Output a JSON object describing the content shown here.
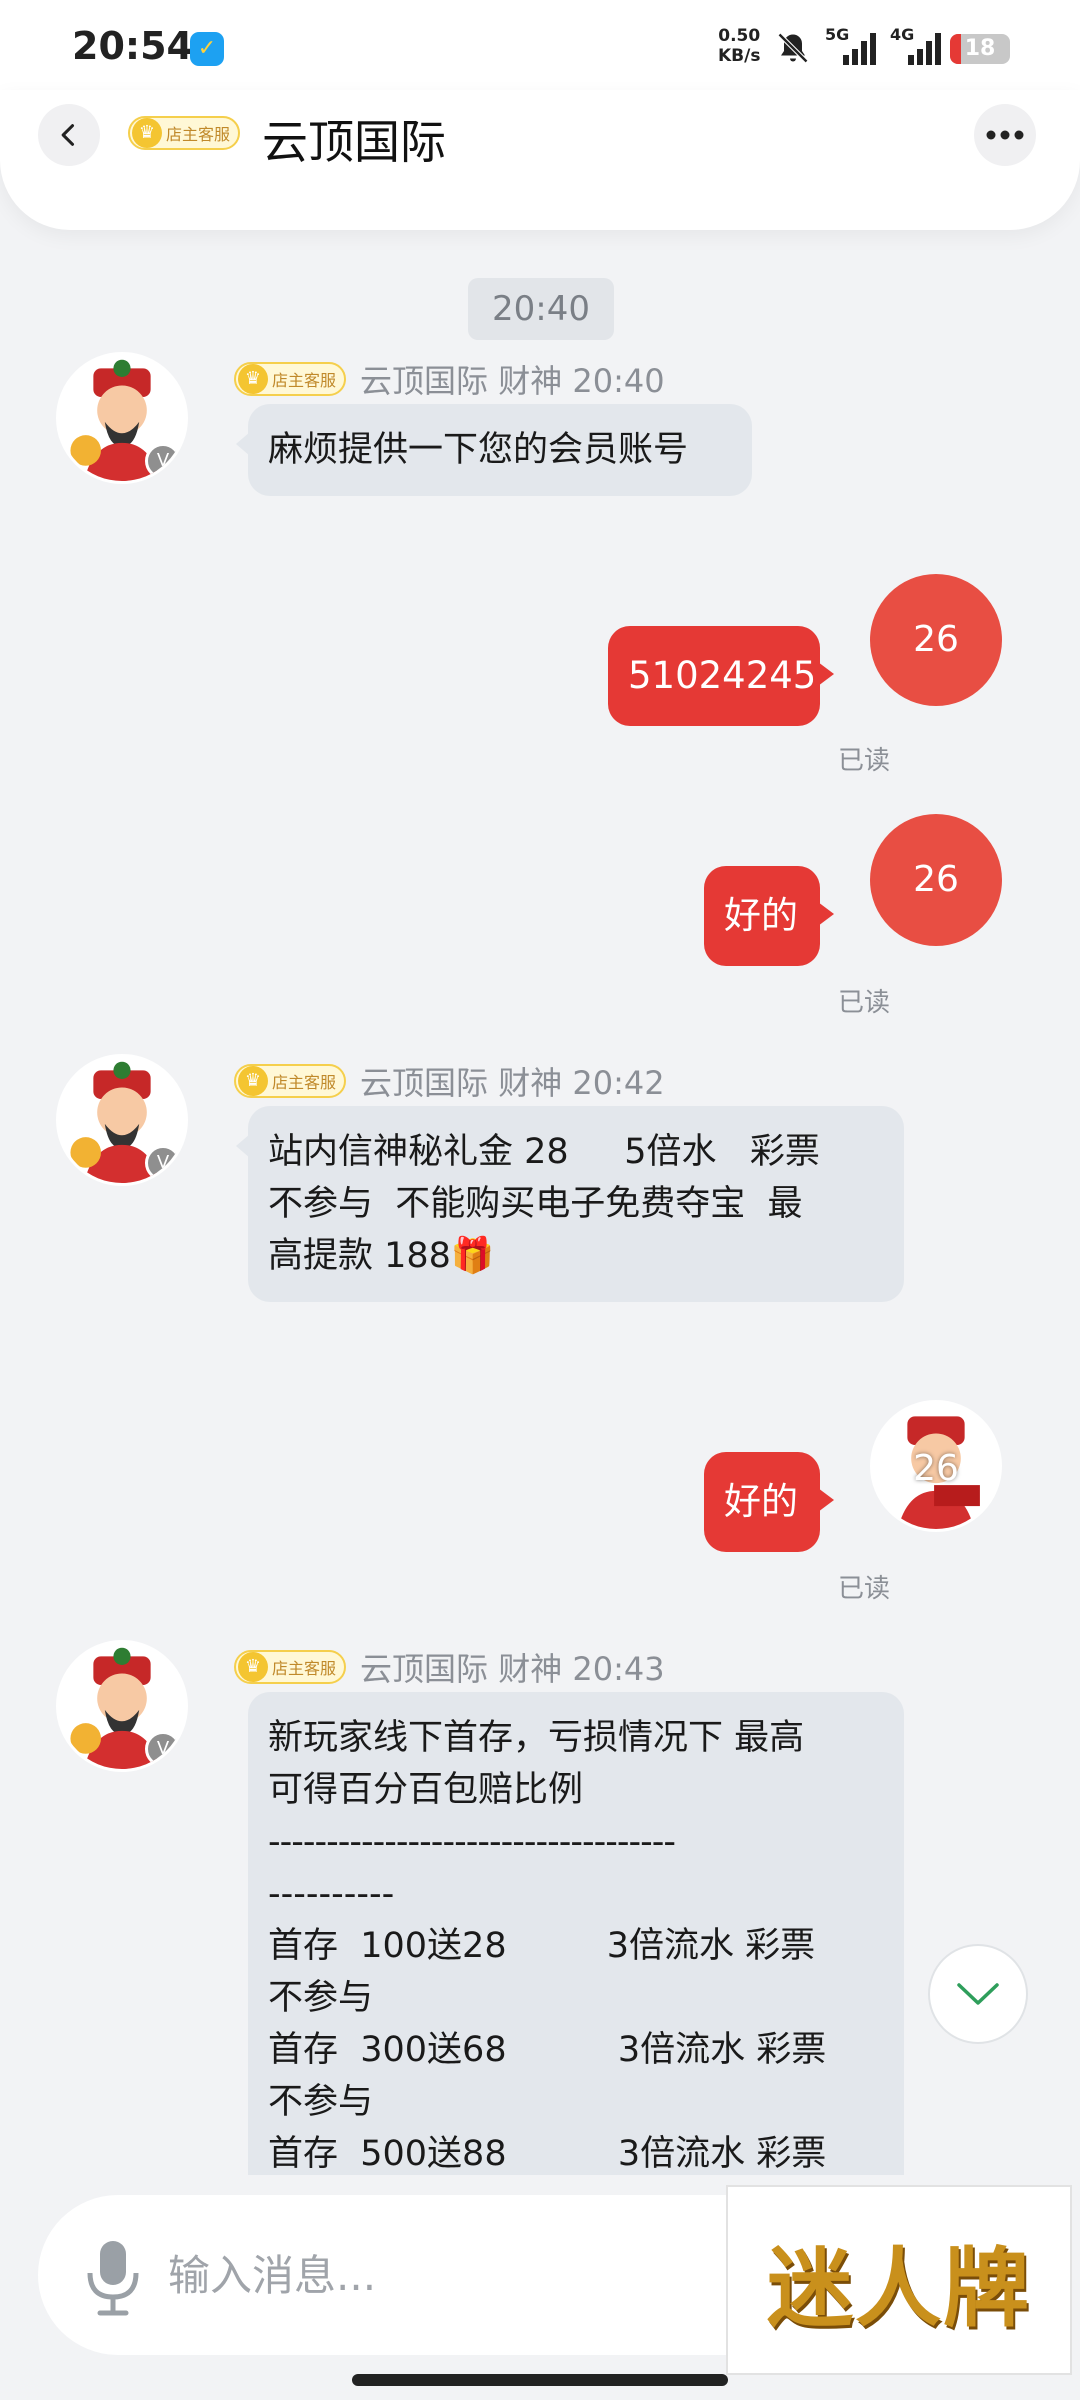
{
  "status_bar": {
    "time": "20:54",
    "net_speed_value": "0.50",
    "net_speed_unit": "KB/s",
    "sim1_label": "5G",
    "sim2_label": "4G",
    "battery": "18",
    "battery_level": 0.18,
    "accent": "#e53935"
  },
  "header": {
    "title": "云顶国际",
    "badge": "店主客服",
    "icons": [
      "back-icon",
      "more-icon"
    ]
  },
  "chat": {
    "time_divider": "20:40",
    "messages": [
      {
        "direction": "in",
        "badge": "店主客服",
        "sender": "云顶国际 财神 20:40",
        "lines": [
          "麻烦提供一下您的会员账号"
        ]
      },
      {
        "direction": "out",
        "text": "51024245",
        "avatar_text": "26",
        "read": "已读"
      },
      {
        "direction": "out",
        "text": "好的",
        "avatar_text": "26",
        "read": "已读"
      },
      {
        "direction": "in",
        "badge": "店主客服",
        "sender": "云顶国际 财神 20:42",
        "lines": [
          "站内信神秘礼金 28     5倍水   彩票",
          "不参与  不能购买电子免费夺宝  最",
          "高提款 188🎁"
        ]
      },
      {
        "direction": "out",
        "text": "好的",
        "avatar_text": "26",
        "read": "已读"
      },
      {
        "direction": "in",
        "badge": "店主客服",
        "sender": "云顶国际 财神 20:43",
        "lines": [
          "新玩家线下首存，亏损情况下 最高",
          "可得百分百包赔比例",
          "-----------------------------------",
          "----------",
          "首存  100送28         3倍流水 彩票",
          "不参与",
          "首存  300送68          3倍流水 彩票",
          "不参与",
          "首存  500送88          3倍流水 彩票"
        ]
      }
    ]
  },
  "input": {
    "placeholder": "输入消息...",
    "brand_text": "迷人牌"
  }
}
